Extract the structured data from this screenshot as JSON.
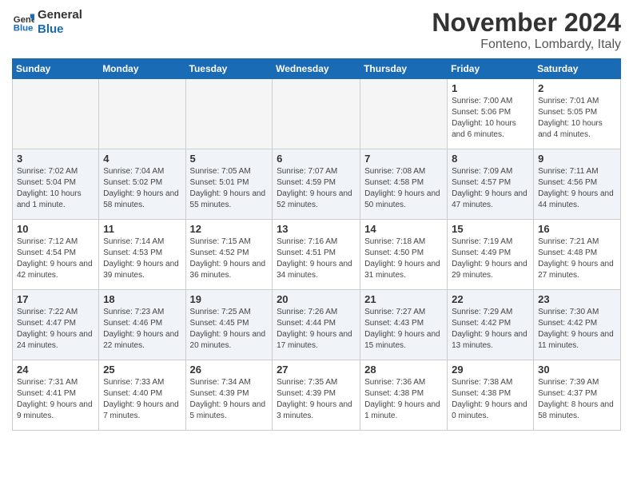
{
  "header": {
    "logo_line1": "General",
    "logo_line2": "Blue",
    "month": "November 2024",
    "location": "Fonteno, Lombardy, Italy"
  },
  "weekdays": [
    "Sunday",
    "Monday",
    "Tuesday",
    "Wednesday",
    "Thursday",
    "Friday",
    "Saturday"
  ],
  "weeks": [
    [
      {
        "day": "",
        "info": ""
      },
      {
        "day": "",
        "info": ""
      },
      {
        "day": "",
        "info": ""
      },
      {
        "day": "",
        "info": ""
      },
      {
        "day": "",
        "info": ""
      },
      {
        "day": "1",
        "info": "Sunrise: 7:00 AM\nSunset: 5:06 PM\nDaylight: 10 hours\nand 6 minutes."
      },
      {
        "day": "2",
        "info": "Sunrise: 7:01 AM\nSunset: 5:05 PM\nDaylight: 10 hours\nand 4 minutes."
      }
    ],
    [
      {
        "day": "3",
        "info": "Sunrise: 7:02 AM\nSunset: 5:04 PM\nDaylight: 10 hours\nand 1 minute."
      },
      {
        "day": "4",
        "info": "Sunrise: 7:04 AM\nSunset: 5:02 PM\nDaylight: 9 hours\nand 58 minutes."
      },
      {
        "day": "5",
        "info": "Sunrise: 7:05 AM\nSunset: 5:01 PM\nDaylight: 9 hours\nand 55 minutes."
      },
      {
        "day": "6",
        "info": "Sunrise: 7:07 AM\nSunset: 4:59 PM\nDaylight: 9 hours\nand 52 minutes."
      },
      {
        "day": "7",
        "info": "Sunrise: 7:08 AM\nSunset: 4:58 PM\nDaylight: 9 hours\nand 50 minutes."
      },
      {
        "day": "8",
        "info": "Sunrise: 7:09 AM\nSunset: 4:57 PM\nDaylight: 9 hours\nand 47 minutes."
      },
      {
        "day": "9",
        "info": "Sunrise: 7:11 AM\nSunset: 4:56 PM\nDaylight: 9 hours\nand 44 minutes."
      }
    ],
    [
      {
        "day": "10",
        "info": "Sunrise: 7:12 AM\nSunset: 4:54 PM\nDaylight: 9 hours\nand 42 minutes."
      },
      {
        "day": "11",
        "info": "Sunrise: 7:14 AM\nSunset: 4:53 PM\nDaylight: 9 hours\nand 39 minutes."
      },
      {
        "day": "12",
        "info": "Sunrise: 7:15 AM\nSunset: 4:52 PM\nDaylight: 9 hours\nand 36 minutes."
      },
      {
        "day": "13",
        "info": "Sunrise: 7:16 AM\nSunset: 4:51 PM\nDaylight: 9 hours\nand 34 minutes."
      },
      {
        "day": "14",
        "info": "Sunrise: 7:18 AM\nSunset: 4:50 PM\nDaylight: 9 hours\nand 31 minutes."
      },
      {
        "day": "15",
        "info": "Sunrise: 7:19 AM\nSunset: 4:49 PM\nDaylight: 9 hours\nand 29 minutes."
      },
      {
        "day": "16",
        "info": "Sunrise: 7:21 AM\nSunset: 4:48 PM\nDaylight: 9 hours\nand 27 minutes."
      }
    ],
    [
      {
        "day": "17",
        "info": "Sunrise: 7:22 AM\nSunset: 4:47 PM\nDaylight: 9 hours\nand 24 minutes."
      },
      {
        "day": "18",
        "info": "Sunrise: 7:23 AM\nSunset: 4:46 PM\nDaylight: 9 hours\nand 22 minutes."
      },
      {
        "day": "19",
        "info": "Sunrise: 7:25 AM\nSunset: 4:45 PM\nDaylight: 9 hours\nand 20 minutes."
      },
      {
        "day": "20",
        "info": "Sunrise: 7:26 AM\nSunset: 4:44 PM\nDaylight: 9 hours\nand 17 minutes."
      },
      {
        "day": "21",
        "info": "Sunrise: 7:27 AM\nSunset: 4:43 PM\nDaylight: 9 hours\nand 15 minutes."
      },
      {
        "day": "22",
        "info": "Sunrise: 7:29 AM\nSunset: 4:42 PM\nDaylight: 9 hours\nand 13 minutes."
      },
      {
        "day": "23",
        "info": "Sunrise: 7:30 AM\nSunset: 4:42 PM\nDaylight: 9 hours\nand 11 minutes."
      }
    ],
    [
      {
        "day": "24",
        "info": "Sunrise: 7:31 AM\nSunset: 4:41 PM\nDaylight: 9 hours\nand 9 minutes."
      },
      {
        "day": "25",
        "info": "Sunrise: 7:33 AM\nSunset: 4:40 PM\nDaylight: 9 hours\nand 7 minutes."
      },
      {
        "day": "26",
        "info": "Sunrise: 7:34 AM\nSunset: 4:39 PM\nDaylight: 9 hours\nand 5 minutes."
      },
      {
        "day": "27",
        "info": "Sunrise: 7:35 AM\nSunset: 4:39 PM\nDaylight: 9 hours\nand 3 minutes."
      },
      {
        "day": "28",
        "info": "Sunrise: 7:36 AM\nSunset: 4:38 PM\nDaylight: 9 hours\nand 1 minute."
      },
      {
        "day": "29",
        "info": "Sunrise: 7:38 AM\nSunset: 4:38 PM\nDaylight: 9 hours\nand 0 minutes."
      },
      {
        "day": "30",
        "info": "Sunrise: 7:39 AM\nSunset: 4:37 PM\nDaylight: 8 hours\nand 58 minutes."
      }
    ]
  ]
}
